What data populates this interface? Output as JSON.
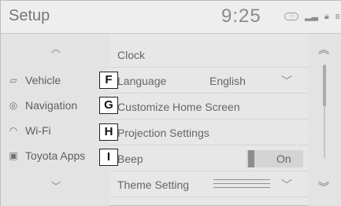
{
  "header": {
    "title": "Setup",
    "time": "9:25"
  },
  "status_icons": [
    "signal-icon",
    "lock-icon",
    "bluetooth-icon"
  ],
  "sidebar": {
    "items": [
      {
        "label": "Vehicle",
        "icon": "car-icon"
      },
      {
        "label": "Navigation",
        "icon": "navigation-icon"
      },
      {
        "label": "Wi-Fi",
        "icon": "wifi-icon"
      },
      {
        "label": "Toyota Apps",
        "icon": "apps-icon"
      }
    ]
  },
  "list": {
    "rows": [
      {
        "label": "Clock"
      },
      {
        "label": "Language",
        "value": "English"
      },
      {
        "label": "Customize Home Screen"
      },
      {
        "label": "Projection Settings"
      },
      {
        "label": "Beep",
        "toggle": "On"
      },
      {
        "label": "Theme Setting"
      }
    ]
  },
  "callouts": [
    "F",
    "G",
    "H",
    "I"
  ]
}
